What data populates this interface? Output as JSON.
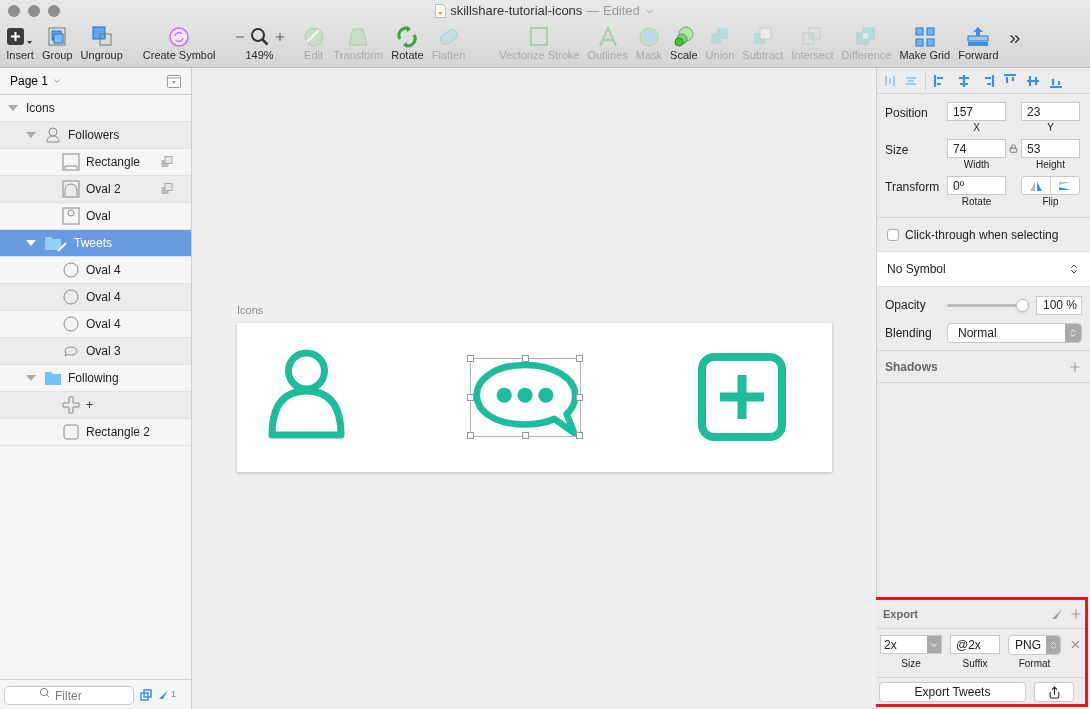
{
  "window": {
    "title": "skillshare-tutorial-icons",
    "status": "— Edited"
  },
  "toolbar": [
    {
      "tools": [
        {
          "kind": "insert",
          "label": "Insert",
          "disabled": false
        },
        {
          "kind": "group",
          "label": "Group",
          "disabled": false
        },
        {
          "kind": "ungroup",
          "label": "Ungroup",
          "disabled": false
        }
      ]
    },
    {
      "tools": [
        {
          "kind": "symbol",
          "label": "Create Symbol",
          "disabled": false
        }
      ]
    },
    {
      "tools": [
        {
          "kind": "zoom",
          "label": "149%",
          "disabled": false
        }
      ]
    },
    {
      "tools": [
        {
          "kind": "edit",
          "label": "Edit",
          "disabled": true
        },
        {
          "kind": "transform",
          "label": "Transform",
          "disabled": true
        },
        {
          "kind": "rotate",
          "label": "Rotate",
          "disabled": false
        },
        {
          "kind": "flatten",
          "label": "Flatten",
          "disabled": true
        }
      ]
    },
    {
      "tools": [
        {
          "kind": "vectorize",
          "label": "Vectorize Stroke",
          "disabled": true
        },
        {
          "kind": "outlines",
          "label": "Outlines",
          "disabled": true
        },
        {
          "kind": "mask",
          "label": "Mask",
          "disabled": true
        },
        {
          "kind": "scale",
          "label": "Scale",
          "disabled": false
        },
        {
          "kind": "union",
          "label": "Union",
          "disabled": true
        },
        {
          "kind": "subtract",
          "label": "Subtract",
          "disabled": true
        },
        {
          "kind": "intersect",
          "label": "Intersect",
          "disabled": true
        },
        {
          "kind": "difference",
          "label": "Difference",
          "disabled": true
        },
        {
          "kind": "grid",
          "label": "Make Grid",
          "disabled": false
        },
        {
          "kind": "forward",
          "label": "Forward",
          "disabled": false
        }
      ]
    }
  ],
  "sidebar": {
    "page": "Page 1",
    "layers": [
      {
        "kind": "artboard",
        "name": "Icons",
        "selected": false,
        "expanded": true,
        "children": [
          {
            "kind": "group",
            "name": "Followers",
            "selected": false,
            "expanded": true,
            "children": [
              {
                "kind": "rectangle",
                "name": "Rectangle",
                "selected": false,
                "boolean_op": true
              },
              {
                "kind": "arch",
                "name": "Oval 2",
                "selected": false,
                "boolean_op": true
              },
              {
                "kind": "oval-frame",
                "name": "Oval",
                "selected": false,
                "boolean_op": false
              }
            ]
          },
          {
            "kind": "folder-edit",
            "name": "Tweets",
            "selected": true,
            "expanded": true,
            "children": [
              {
                "kind": "oval",
                "name": "Oval 4",
                "selected": false,
                "boolean_op": false
              },
              {
                "kind": "oval",
                "name": "Oval 4",
                "selected": false,
                "boolean_op": false
              },
              {
                "kind": "oval",
                "name": "Oval 4",
                "selected": false,
                "boolean_op": false
              },
              {
                "kind": "bubble",
                "name": "Oval 3",
                "selected": false,
                "boolean_op": false
              }
            ]
          },
          {
            "kind": "folder",
            "name": "Following",
            "selected": false,
            "expanded": true,
            "children": [
              {
                "kind": "cross",
                "name": "+",
                "selected": false,
                "boolean_op": false
              },
              {
                "kind": "square",
                "name": "Rectangle 2",
                "selected": false,
                "boolean_op": false
              }
            ]
          }
        ]
      }
    ],
    "filter": {
      "placeholder": "Filter"
    },
    "selection_count": "1"
  },
  "canvas": {
    "artboard": {
      "label": "Icons"
    }
  },
  "inspector": {
    "geometry": [
      {
        "label": "Position",
        "fields": [
          {
            "kind": "field",
            "value": "157",
            "caption": "X"
          },
          {
            "kind": "field",
            "value": "23",
            "caption": "Y"
          }
        ]
      },
      {
        "label": "Size",
        "fields": [
          {
            "kind": "field",
            "value": "74",
            "caption": "Width"
          },
          {
            "kind": "field",
            "value": "53",
            "caption": "Height"
          }
        ]
      },
      {
        "label": "Transform",
        "fields": [
          {
            "kind": "field",
            "value": "0º",
            "caption": "Rotate"
          },
          {
            "kind": "flip",
            "caption": "Flip"
          }
        ]
      }
    ],
    "click_through": {
      "label": "Click-through when selecting",
      "checked": false
    },
    "symbol": "No Symbol",
    "opacity": {
      "label": "Opacity",
      "level": 1,
      "reading": "100 %"
    },
    "blending": {
      "label": "Blending",
      "value": "Normal"
    },
    "shadows": {
      "title": "Shadows"
    },
    "export": {
      "title": "Export",
      "size": {
        "value": "2x",
        "caption": "Size"
      },
      "suffix": {
        "value": "@2x",
        "caption": "Suffix"
      },
      "format": {
        "value": "PNG",
        "caption": "Format"
      },
      "button": "Export Tweets"
    }
  }
}
